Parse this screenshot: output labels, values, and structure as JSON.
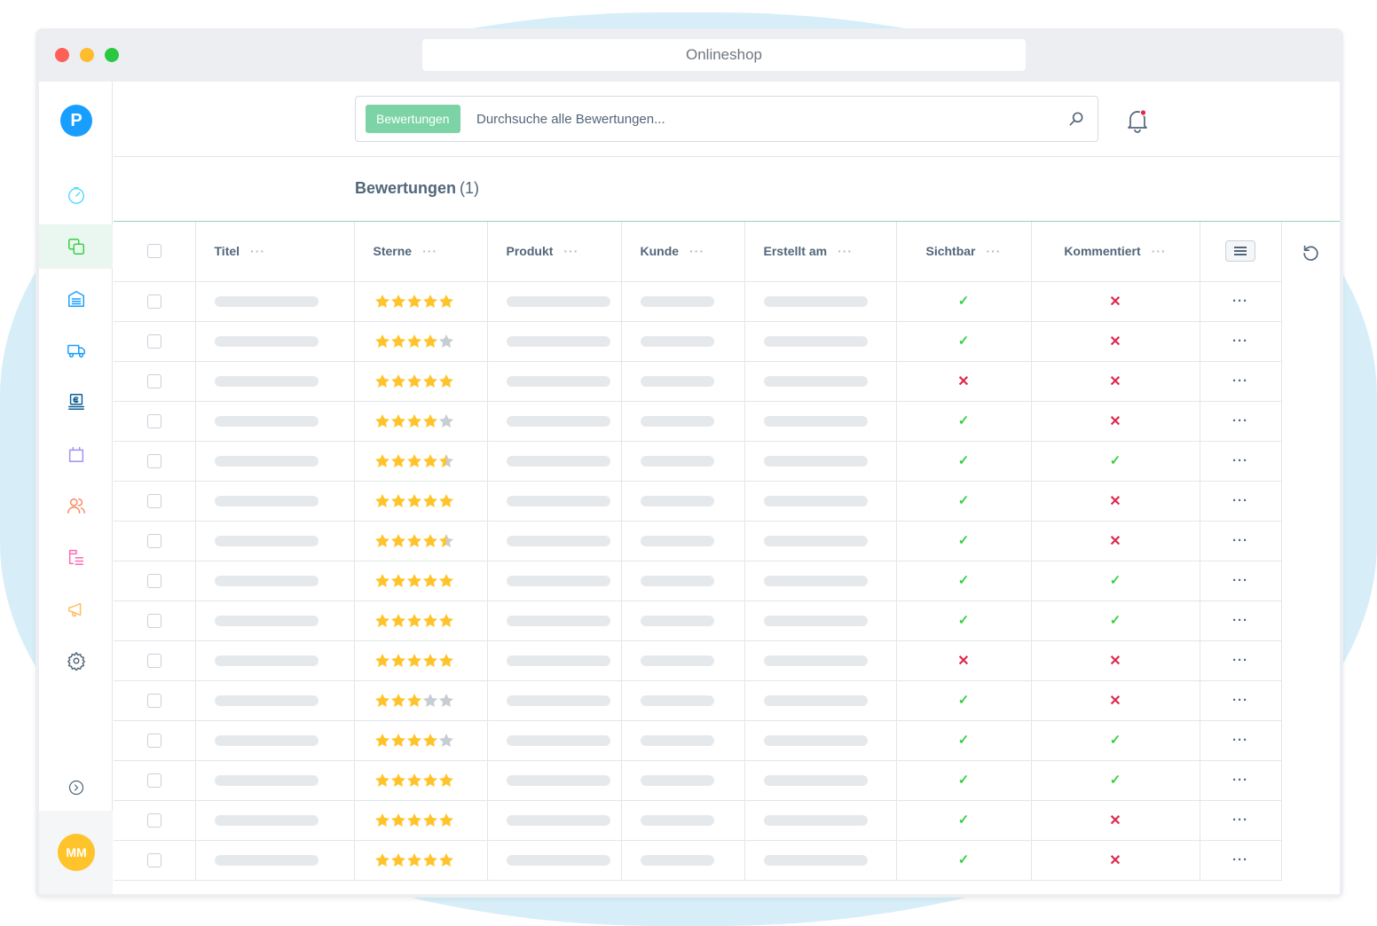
{
  "browser": {
    "address": "Onlineshop"
  },
  "sidebar": {
    "logo_letter": "P",
    "nav_icons": [
      "dashboard-icon",
      "catalogues-icon",
      "warehouse-icon",
      "shipping-icon",
      "payment-icon",
      "orders-icon",
      "customers-icon",
      "content-icon",
      "marketing-icon",
      "settings-icon"
    ],
    "active_item": "catalogues-icon",
    "expand_icon": "chevron-right-icon",
    "user_initials": "MM"
  },
  "search": {
    "chip": "Bewertungen",
    "placeholder": "Durchsuche alle Bewertungen..."
  },
  "page": {
    "title": "Bewertungen",
    "count": "(1)"
  },
  "columns": [
    "Titel",
    "Sterne",
    "Produkt",
    "Kunde",
    "Erstellt am",
    "Sichtbar",
    "Kommentiert"
  ],
  "rows": [
    {
      "stars": 5,
      "visible": true,
      "commented": false
    },
    {
      "stars": 4,
      "visible": true,
      "commented": false
    },
    {
      "stars": 5,
      "visible": false,
      "commented": false
    },
    {
      "stars": 4,
      "visible": true,
      "commented": false
    },
    {
      "stars": 4.5,
      "visible": true,
      "commented": true
    },
    {
      "stars": 5,
      "visible": true,
      "commented": false
    },
    {
      "stars": 4.5,
      "visible": true,
      "commented": false
    },
    {
      "stars": 5,
      "visible": true,
      "commented": true
    },
    {
      "stars": 5,
      "visible": true,
      "commented": true
    },
    {
      "stars": 5,
      "visible": false,
      "commented": false
    },
    {
      "stars": 3,
      "visible": true,
      "commented": false
    },
    {
      "stars": 4,
      "visible": true,
      "commented": true
    },
    {
      "stars": 5,
      "visible": true,
      "commented": true
    },
    {
      "stars": 5,
      "visible": true,
      "commented": false
    },
    {
      "stars": 5,
      "visible": true,
      "commented": false
    }
  ],
  "colors": {
    "accent": "#7cd4a6",
    "star_filled": "#ffc42b",
    "star_empty": "#c6cdd3",
    "check": "#37d046",
    "cross": "#de294c",
    "logo": "#189eff"
  }
}
